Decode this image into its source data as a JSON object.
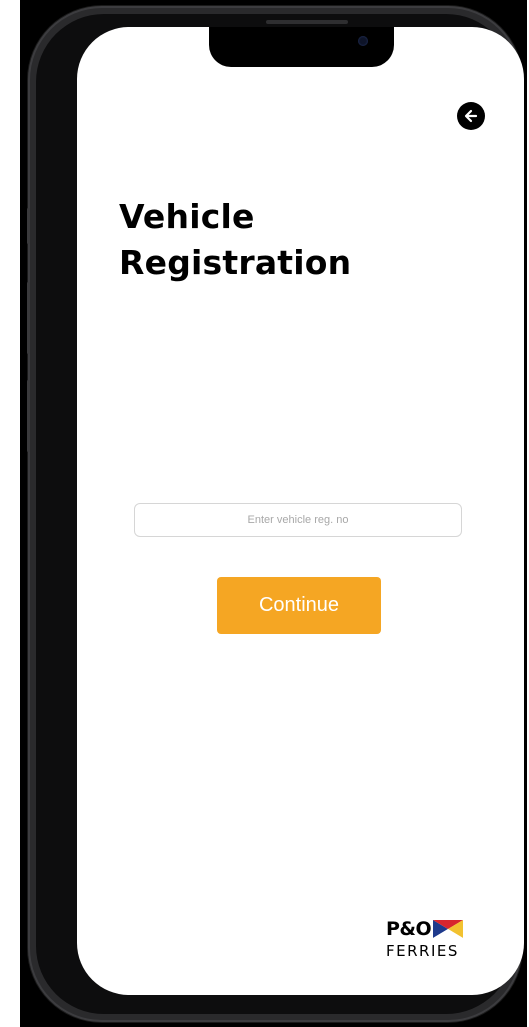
{
  "screen": {
    "title_line_1": "Vehicle",
    "title_line_2": "Registration"
  },
  "navigation": {
    "back_icon": "arrow-left-icon"
  },
  "form": {
    "registration_placeholder": "Enter vehicle reg. no",
    "registration_value": "",
    "continue_label": "Continue"
  },
  "brand": {
    "logo_wordmark_top": "P&O",
    "logo_wordmark_bottom": "FERRIES",
    "logo_flag_icon": "po-flag-icon"
  },
  "colors": {
    "accent": "#F5A623",
    "text": "#000000",
    "screen_background": "#FFFFFF",
    "device_frame": "#2A2A2C",
    "backdrop": "#000000",
    "flag_blue": "#1E3A8C",
    "flag_red": "#D7262E",
    "flag_yellow": "#F2C230",
    "flag_white": "#FFFFFF"
  }
}
